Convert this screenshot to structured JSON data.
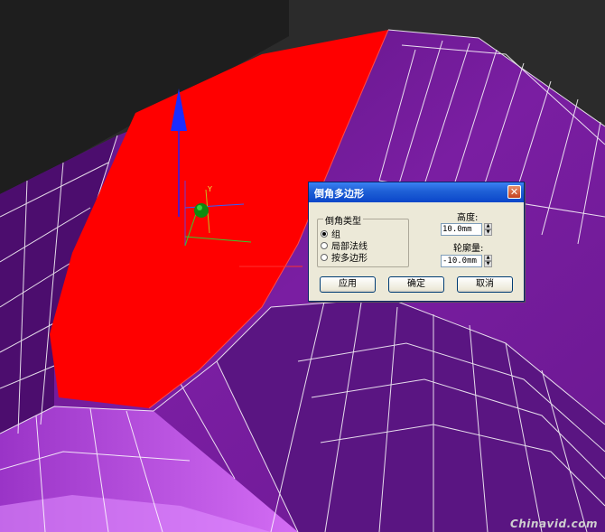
{
  "dialog": {
    "title": "倒角多边形",
    "close_glyph": "✕",
    "group_label": "倒角类型",
    "options": [
      {
        "label": "组",
        "selected": true
      },
      {
        "label": "局部法线",
        "selected": false
      },
      {
        "label": "按多边形",
        "selected": false
      }
    ],
    "height_label": "高度:",
    "height_value": "10.0mm",
    "outline_label": "轮廓量:",
    "outline_value": "-10.0mm",
    "apply_label": "应用",
    "ok_label": "确定",
    "cancel_label": "取消"
  },
  "gizmo": {
    "y_axis_label": "Y"
  },
  "watermark": "Chinavid.com",
  "colors": {
    "selected_face": "#ff0000",
    "mesh_dark": "#551178",
    "mesh_mid": "#751a9c",
    "mesh_light": "#c24dee",
    "wire": "#ffffff",
    "titlebar": "#0b46c9"
  }
}
